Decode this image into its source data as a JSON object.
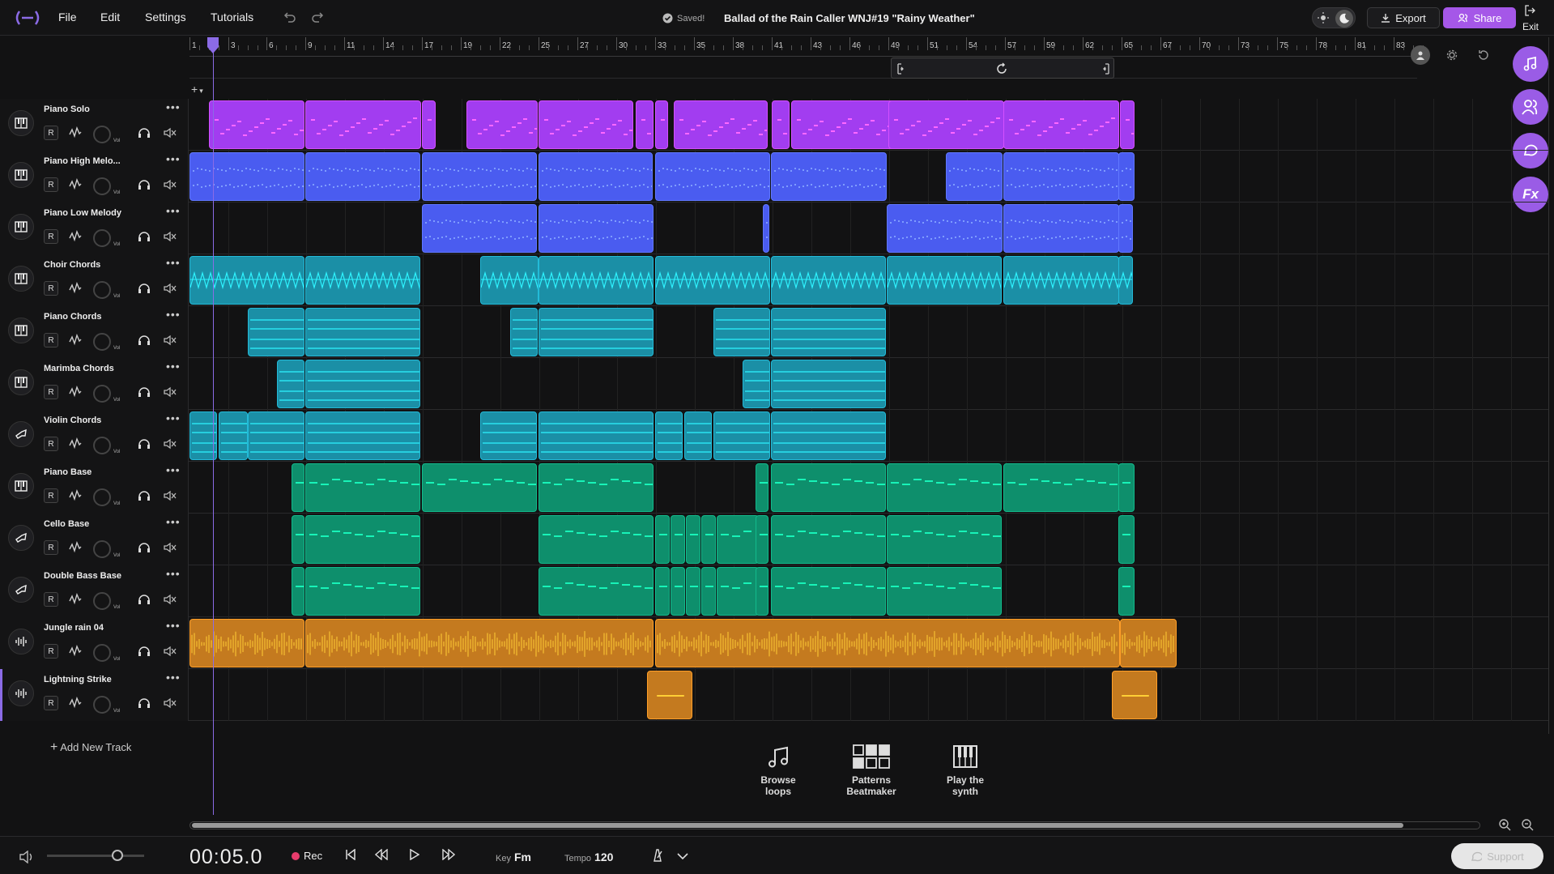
{
  "topbar": {
    "menu": [
      "File",
      "Edit",
      "Settings",
      "Tutorials"
    ],
    "saved_label": "Saved!",
    "project_title": "Ballad of the Rain Caller WNJ#19 \"Rainy Weather\"",
    "export_label": "Export",
    "share_label": "Share",
    "exit_label": "Exit"
  },
  "ruler": {
    "bars": [
      "1",
      "3",
      "6",
      "9",
      "11",
      "14",
      "17",
      "19",
      "22",
      "25",
      "27",
      "30",
      "33",
      "35",
      "38",
      "41",
      "43",
      "46",
      "49",
      "51",
      "54",
      "57",
      "59",
      "62",
      "65",
      "67",
      "70",
      "73",
      "75",
      "78",
      "81",
      "83"
    ]
  },
  "add_track_mini": "+",
  "tracks": [
    {
      "name": "Piano Solo",
      "icon": "piano-icon",
      "color": "#a23df0",
      "record": "R",
      "vol_label": "Vol"
    },
    {
      "name": "Piano High Melo...",
      "icon": "piano-icon",
      "color": "#4a5cf0",
      "record": "R",
      "vol_label": "Vol"
    },
    {
      "name": "Piano Low Melody",
      "icon": "piano-icon",
      "color": "#4a5cf0",
      "record": "R",
      "vol_label": "Vol"
    },
    {
      "name": "Choir Chords",
      "icon": "piano-icon",
      "color": "#1b8fa6",
      "record": "R",
      "vol_label": "Vol"
    },
    {
      "name": "Piano Chords",
      "icon": "piano-icon",
      "color": "#1b8fa6",
      "record": "R",
      "vol_label": "Vol"
    },
    {
      "name": "Marimba Chords",
      "icon": "piano-icon",
      "color": "#1b8fa6",
      "record": "R",
      "vol_label": "Vol"
    },
    {
      "name": "Violin Chords",
      "icon": "horn-icon",
      "color": "#1b8fa6",
      "record": "R",
      "vol_label": "Vol"
    },
    {
      "name": "Piano Base",
      "icon": "piano-icon",
      "color": "#0e8f6c",
      "record": "R",
      "vol_label": "Vol"
    },
    {
      "name": "Cello Base",
      "icon": "horn-icon",
      "color": "#0e8f6c",
      "record": "R",
      "vol_label": "Vol"
    },
    {
      "name": "Double Bass Base",
      "icon": "horn-icon",
      "color": "#0e8f6c",
      "record": "R",
      "vol_label": "Vol"
    },
    {
      "name": "Jungle rain 04",
      "icon": "waveform-icon",
      "color": "#c47a1f",
      "record": "R",
      "vol_label": "Vol"
    },
    {
      "name": "Lightning Strike",
      "icon": "waveform-icon",
      "color": "#c47a1f",
      "record": "R",
      "vol_label": "Vol"
    }
  ],
  "add_new_track_label": "Add New Track",
  "actions": [
    {
      "label_1": "Browse",
      "label_2": "loops"
    },
    {
      "label_1": "Patterns",
      "label_2": "Beatmaker"
    },
    {
      "label_1": "Play the",
      "label_2": "synth"
    }
  ],
  "transport": {
    "time": "00:05.0",
    "rec_label": "Rec",
    "key_label": "Key",
    "key_value": "Fm",
    "tempo_label": "Tempo",
    "tempo_value": "120",
    "support_label": "Support"
  },
  "colors": {
    "accent": "#9a5ce6",
    "share": "#a557e8",
    "rec": "#e83c6c"
  }
}
